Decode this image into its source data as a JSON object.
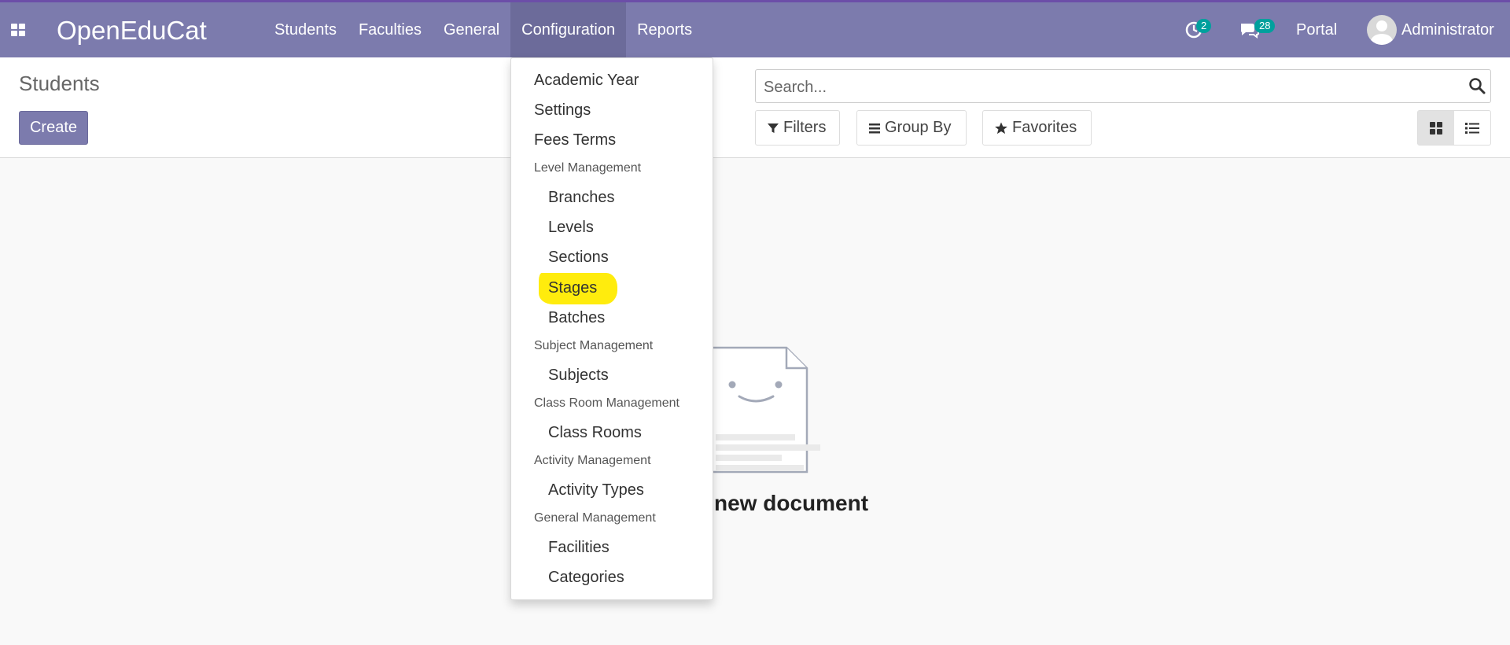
{
  "app": {
    "brand": "OpenEduCat"
  },
  "nav": {
    "menus": [
      "Students",
      "Faculties",
      "General",
      "Configuration",
      "Reports"
    ],
    "activity_count": "2",
    "message_count": "28",
    "portal": "Portal",
    "user": "Administrator"
  },
  "control_panel": {
    "title": "Students",
    "create_label": "Create",
    "search_placeholder": "Search...",
    "filters_label": "Filters",
    "group_by_label": "Group By",
    "favorites_label": "Favorites"
  },
  "dropdown": {
    "academic_year": "Academic Year",
    "settings": "Settings",
    "fees_terms": "Fees Terms",
    "level_management": "Level Management",
    "branches": "Branches",
    "levels": "Levels",
    "sections": "Sections",
    "stages": "Stages",
    "batches": "Batches",
    "subject_management": "Subject Management",
    "subjects": "Subjects",
    "class_room_management": "Class Room Management",
    "class_rooms": "Class Rooms",
    "activity_management": "Activity Management",
    "activity_types": "Activity Types",
    "general_management": "General Management",
    "facilities": "Facilities",
    "categories": "Categories"
  },
  "empty_state": {
    "text": "new document"
  },
  "colors": {
    "navbar": "#7c7bad",
    "navbar_active": "#6c6b9a",
    "badge": "#00a09d",
    "highlight": "#ffeb00"
  },
  "icons": [
    "apps-icon",
    "activity-clock-icon",
    "chat-icon",
    "avatar",
    "search-icon",
    "filter-icon",
    "group-by-icon",
    "star-icon",
    "kanban-view-icon",
    "list-view-icon"
  ]
}
